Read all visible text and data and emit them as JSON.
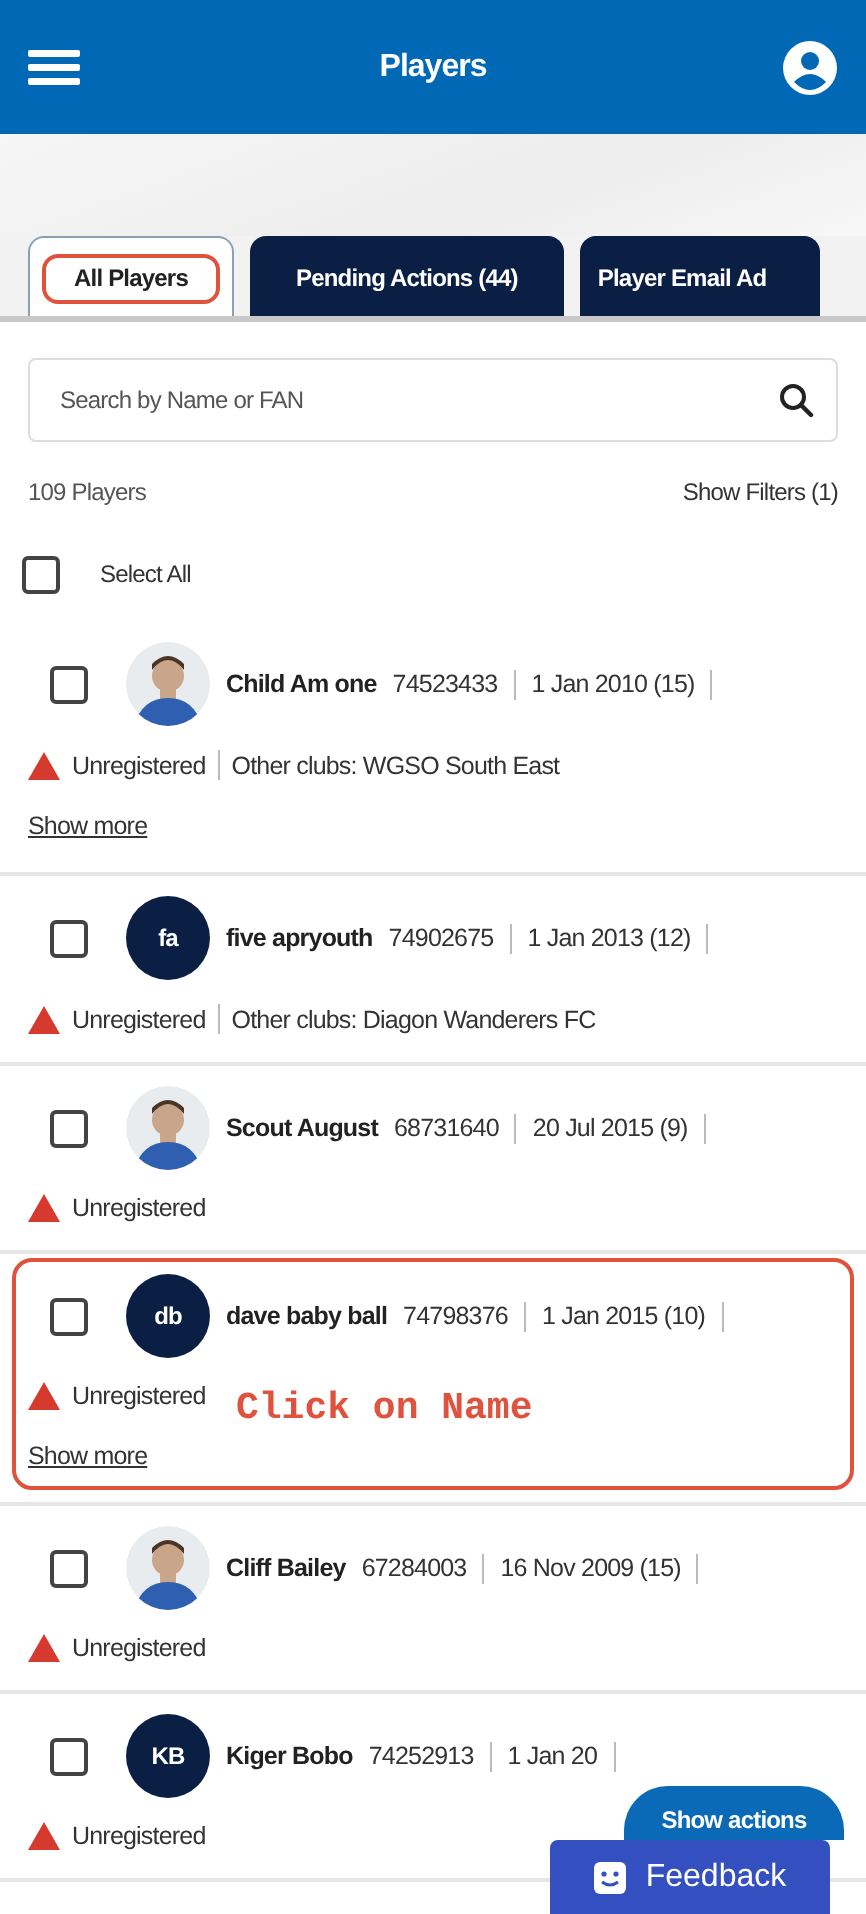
{
  "header": {
    "title": "Players"
  },
  "tabs": [
    {
      "label": "All Players",
      "selected": true,
      "annotated": true
    },
    {
      "label": "Pending Actions (44)",
      "selected": false,
      "annotated": false
    },
    {
      "label": "Player Email Ad",
      "selected": false,
      "annotated": false
    }
  ],
  "search": {
    "placeholder": "Search by Name or FAN"
  },
  "summary": {
    "count": "109 Players",
    "filters": "Show Filters (1)"
  },
  "select_all": {
    "label": "Select All",
    "checked": false
  },
  "players": [
    {
      "name": "Child Am one",
      "fan": "74523433",
      "dob": "1 Jan 2010 (15)",
      "status": "Unregistered",
      "other_clubs": "Other clubs: WGSO South East",
      "show_more": "Show more",
      "checked": false,
      "highlighted": false
    },
    {
      "name": "five apryouth",
      "fan": "74902675",
      "dob": "1 Jan 2013 (12)",
      "avatar": {
        "kind": "initials",
        "text": "fa"
      },
      "status": "Unregistered",
      "other_clubs": "Other clubs: Diagon Wanderers FC",
      "checked": false,
      "highlighted": false
    },
    {
      "name": "Scout August",
      "fan": "68731640",
      "dob": "20 Jul 2015 (9)",
      "status": "Unregistered",
      "checked": false,
      "highlighted": false
    },
    {
      "name": "dave baby ball",
      "fan": "74798376",
      "dob": "1 Jan 2015 (10)",
      "avatar": {
        "kind": "initials",
        "text": "db"
      },
      "status": "Unregistered",
      "show_more": "Show more",
      "checked": false,
      "highlighted": true,
      "annotation": "Click on Name"
    },
    {
      "name": "Cliff Bailey",
      "fan": "67284003",
      "dob": "16 Nov 2009 (15)",
      "status": "Unregistered",
      "checked": false,
      "highlighted": false
    },
    {
      "name": "Kiger Bobo",
      "fan": "74252913",
      "dob": "1 Jan 20",
      "avatar": {
        "kind": "initials",
        "text": "KB"
      },
      "status": "Unregistered",
      "checked": false,
      "highlighted": false
    }
  ],
  "show_actions": "Show actions",
  "feedback": "Feedback"
}
